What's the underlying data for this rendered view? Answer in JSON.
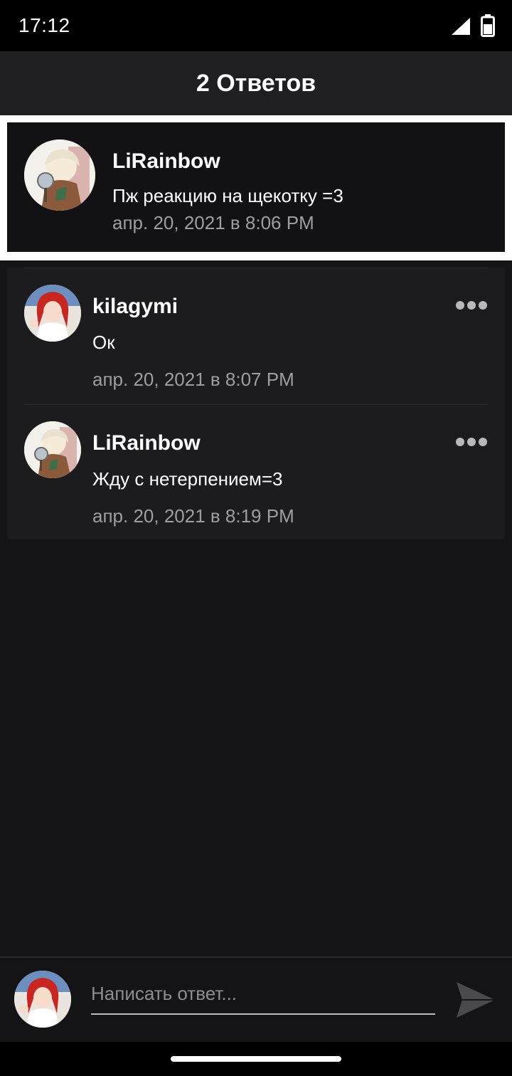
{
  "status_bar": {
    "time": "17:12",
    "icons": [
      "signal-icon",
      "battery-icon"
    ]
  },
  "header": {
    "title": "2 Ответов"
  },
  "parent_comment": {
    "author": "LiRainbow",
    "text": "Пж реакцию на щекотку =3",
    "timestamp": "апр. 20, 2021 в 8:06 PM",
    "avatar_icon": "anime-avatar-icon"
  },
  "replies": [
    {
      "author": "kilagymi",
      "text": "Ок",
      "timestamp": "апр. 20, 2021 в 8:07 PM",
      "avatar_icon": "redhead-avatar-icon",
      "menu_icon": "more-options-icon"
    },
    {
      "author": "LiRainbow",
      "text": "Жду с нетерпением=3",
      "timestamp": "апр. 20, 2021 в 8:19 PM",
      "avatar_icon": "anime-avatar-icon",
      "menu_icon": "more-options-icon"
    }
  ],
  "composer": {
    "placeholder": "Написать ответ...",
    "value": "",
    "send_icon": "send-icon"
  },
  "colors": {
    "background": "#141315",
    "card": "#1c1b1d",
    "muted_text": "#9e9d9f"
  }
}
